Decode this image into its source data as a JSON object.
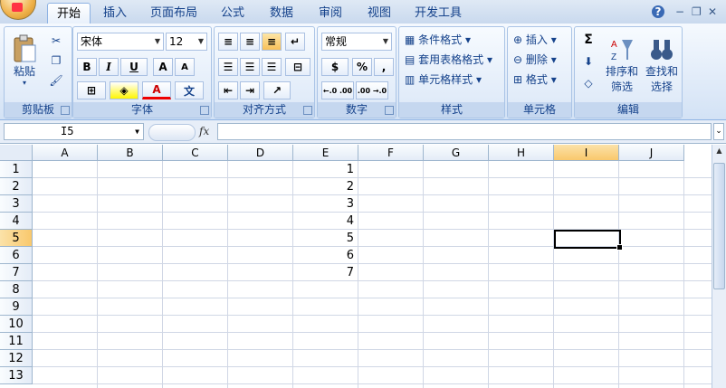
{
  "tabs": [
    "开始",
    "插入",
    "页面布局",
    "公式",
    "数据",
    "审阅",
    "视图",
    "开发工具"
  ],
  "window_controls": {
    "help": "?",
    "minimize": "−",
    "restore": "❐",
    "close": "✕"
  },
  "clipboard": {
    "paste_label": "粘贴",
    "group_label": "剪贴板"
  },
  "font": {
    "name": "宋体",
    "size": "12",
    "bold": "B",
    "italic": "I",
    "underline": "U",
    "grow": "A",
    "shrink": "A",
    "color_letter": "A",
    "phonetic": "文",
    "group_label": "字体"
  },
  "alignment": {
    "group_label": "对齐方式"
  },
  "number": {
    "format": "常规",
    "percent": "%",
    "comma": ",",
    "inc_decimal": "←.0 .00",
    "dec_decimal": ".00 →.0",
    "group_label": "数字"
  },
  "styles": {
    "conditional": "条件格式",
    "table_format": "套用表格格式",
    "cell_styles": "单元格样式",
    "group_label": "样式"
  },
  "cells": {
    "insert": "插入",
    "delete": "删除",
    "format": "格式",
    "group_label": "单元格"
  },
  "editing": {
    "sum": "Σ",
    "sort_filter_1": "排序和",
    "sort_filter_2": "筛选",
    "find_select_1": "查找和",
    "find_select_2": "选择",
    "group_label": "编辑"
  },
  "formula_bar": {
    "name_box": "I5",
    "fx": "fx",
    "formula": ""
  },
  "sheet": {
    "columns": [
      "A",
      "B",
      "C",
      "D",
      "E",
      "F",
      "G",
      "H",
      "I",
      "J"
    ],
    "selected_column": "I",
    "rows": [
      "1",
      "2",
      "3",
      "4",
      "5",
      "6",
      "7",
      "8",
      "9",
      "10",
      "11",
      "12",
      "13"
    ],
    "selected_row": "5",
    "values_col_E": [
      "1",
      "2",
      "3",
      "4",
      "5",
      "6",
      "7"
    ],
    "selected_cell": "I5"
  },
  "colors": {
    "accent": "#15428b",
    "selection": "#f9c86c",
    "grid": "#d0d7e5"
  }
}
